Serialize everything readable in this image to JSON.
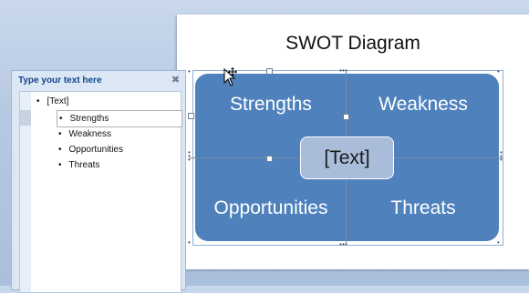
{
  "slide": {
    "title": "SWOT Diagram"
  },
  "smartart": {
    "quadrants": {
      "strengths": "Strengths",
      "weakness": "Weakness",
      "opportunities": "Opportunities",
      "threats": "Threats"
    },
    "center_text": "[Text]",
    "colors": {
      "fill": "#4f81bd",
      "center_fill": "#a9bddb"
    }
  },
  "text_pane": {
    "title": "Type your text here",
    "close_icon": "close-icon",
    "items": [
      {
        "label": "[Text]"
      },
      {
        "label": "Strengths"
      },
      {
        "label": "Weakness"
      },
      {
        "label": "Opportunities"
      },
      {
        "label": "Threats"
      }
    ]
  },
  "cursor": "move-cursor-icon"
}
